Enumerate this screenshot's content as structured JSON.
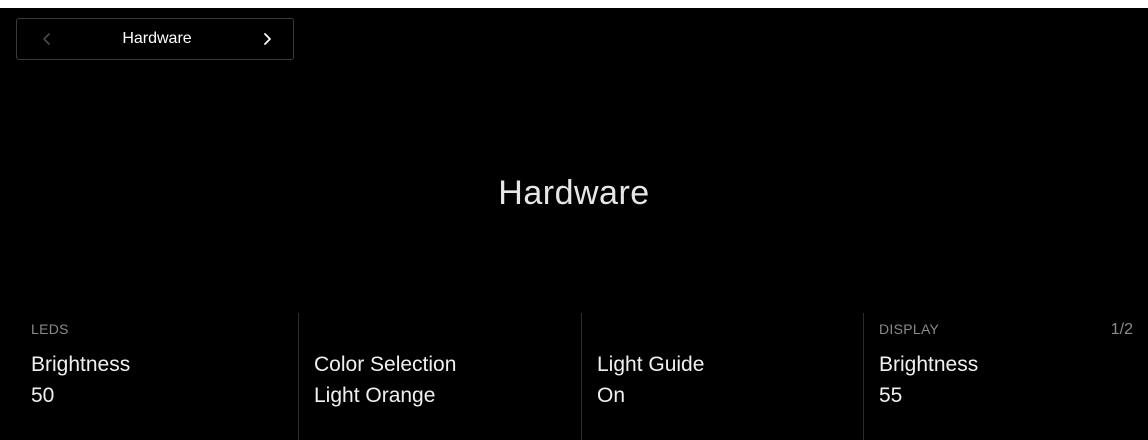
{
  "header": {
    "section_label": "Hardware",
    "prev_icon": "chevron-left-icon",
    "next_icon": "chevron-right-icon"
  },
  "main": {
    "title": "Hardware"
  },
  "params": [
    {
      "group": "LEDS",
      "name": "Brightness",
      "value": "50"
    },
    {
      "group": "",
      "name": "Color Selection",
      "value": "Light Orange"
    },
    {
      "group": "",
      "name": "Light Guide",
      "value": "On"
    },
    {
      "group": "DISPLAY",
      "name": "Brightness",
      "value": "55"
    }
  ],
  "pagination": {
    "label": "1/2"
  },
  "colors": {
    "background": "#000000",
    "text": "#ffffff",
    "muted": "#8a8a8a",
    "divider": "#2c2c2c"
  }
}
